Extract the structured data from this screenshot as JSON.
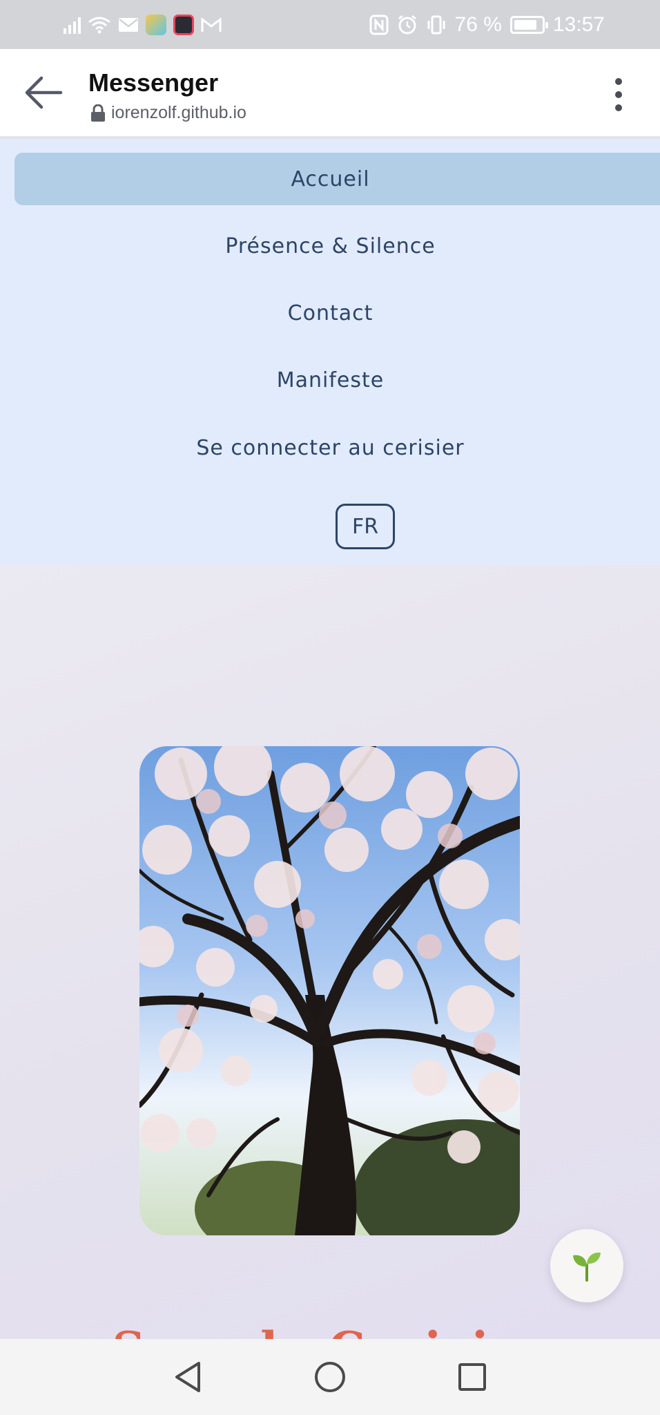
{
  "status_bar": {
    "battery": "76 %",
    "time": "13:57"
  },
  "browser": {
    "title": "Messenger",
    "url": "iorenzolf.github.io"
  },
  "nav": {
    "items": [
      {
        "label": "Accueil",
        "active": true
      },
      {
        "label": "Présence & Silence",
        "active": false
      },
      {
        "label": "Contact",
        "active": false
      },
      {
        "label": "Manifeste",
        "active": false
      },
      {
        "label": "Se connecter au cerisier",
        "active": false
      }
    ],
    "language": "FR"
  },
  "main": {
    "heading_peek": "Sous le Cerisier"
  },
  "icons": {
    "back": "arrow-left-icon",
    "menu": "more-vertical-icon",
    "lock": "lock-icon",
    "fab": "sprout-icon"
  },
  "colors": {
    "nav_bg": "#e1ebfb",
    "nav_active": "#b2cde6",
    "heading_accent": "#e0644e"
  }
}
